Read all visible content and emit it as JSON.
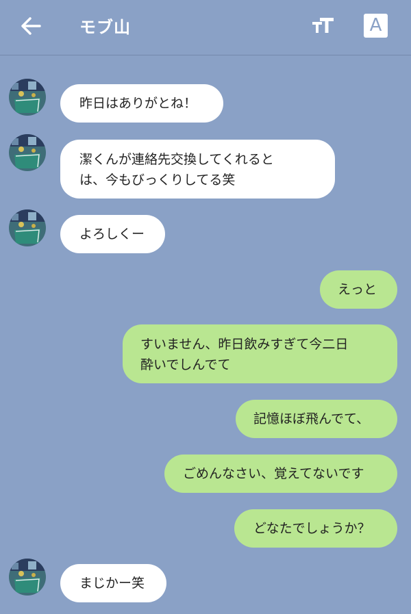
{
  "header": {
    "title": "モブ山",
    "translate_label": "A"
  },
  "colors": {
    "background": "#8aa1c6",
    "incoming_bubble": "#ffffff",
    "outgoing_bubble": "#b9e691"
  },
  "icons": {
    "back": "back-arrow-icon",
    "font_size": "font-size-icon",
    "translate": "translate-icon"
  },
  "messages": [
    {
      "side": "in",
      "text": "昨日はありがとね！"
    },
    {
      "side": "in",
      "text": "潔くんが連絡先交換してくれると\nは、今もびっくりしてる笑"
    },
    {
      "side": "in",
      "text": "よろしくー"
    },
    {
      "side": "out",
      "text": "えっと"
    },
    {
      "side": "out",
      "text": "すいません、昨日飲みすぎて今二日\n酔いでしんでて"
    },
    {
      "side": "out",
      "text": "記憶ほぼ飛んでて、"
    },
    {
      "side": "out",
      "text": "ごめんなさい、覚えてないです"
    },
    {
      "side": "out",
      "text": "どなたでしょうか？"
    },
    {
      "side": "in",
      "text": "まじかー笑"
    }
  ]
}
